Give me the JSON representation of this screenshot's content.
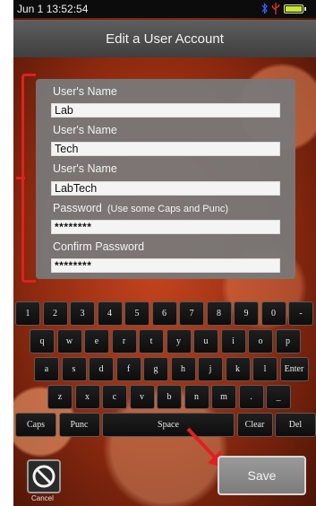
{
  "status_bar": {
    "time": "Jun  1 13:52:54"
  },
  "title": "Edit a User Account",
  "form": {
    "fields": [
      {
        "label": "User's Name",
        "value": "Lab"
      },
      {
        "label": "User's Name",
        "value": "Tech"
      },
      {
        "label": "User's Name",
        "value": "LabTech"
      }
    ],
    "password": {
      "label": "Password",
      "hint": "(Use some Caps and Punc)",
      "value": "********"
    },
    "confirm_password": {
      "label": "Confirm Password",
      "value": "********"
    }
  },
  "keyboard": {
    "row1": [
      "1",
      "2",
      "3",
      "4",
      "5",
      "6",
      "7",
      "8",
      "9",
      "0",
      "-"
    ],
    "row2": [
      "q",
      "w",
      "e",
      "r",
      "t",
      "y",
      "u",
      "i",
      "o",
      "p"
    ],
    "row3": [
      "a",
      "s",
      "d",
      "f",
      "g",
      "h",
      "j",
      "k",
      "l",
      "Enter"
    ],
    "row4": [
      "z",
      "x",
      "c",
      "v",
      "b",
      "n",
      "m",
      ".",
      "_"
    ],
    "row5": [
      "Caps",
      "Punc",
      "Space",
      "Clear",
      "Del"
    ]
  },
  "buttons": {
    "cancel_label": "Cancel",
    "save_label": "Save"
  },
  "colors": {
    "accent_red": "#e02020",
    "title_bar": "#4f4f4f",
    "battery": "#c9e63a"
  }
}
